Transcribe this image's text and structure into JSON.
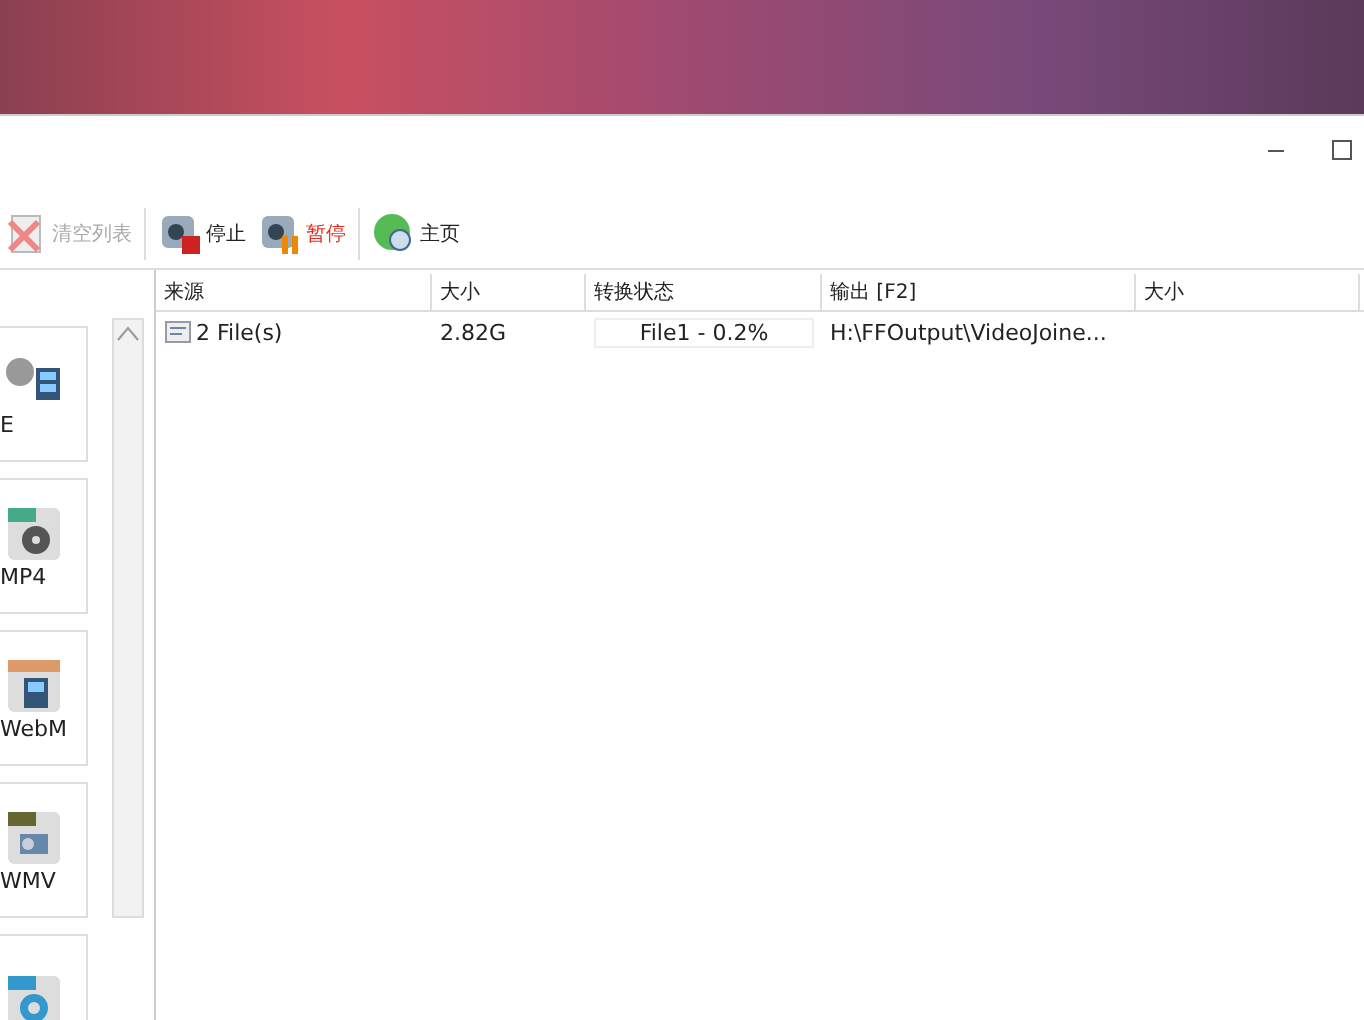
{
  "toolbar": [
    {
      "label": "清空列表",
      "kind": "clear",
      "disabled": true,
      "highlighted": false
    },
    {
      "label": "停止",
      "kind": "stop",
      "disabled": false,
      "highlighted": false
    },
    {
      "label": "暂停",
      "kind": "pause",
      "disabled": false,
      "highlighted": true
    },
    {
      "label": "主页",
      "kind": "home",
      "disabled": false,
      "highlighted": false
    }
  ],
  "formats": [
    {
      "label": "E",
      "kind": "join"
    },
    {
      "label": "MP4",
      "kind": "mp4"
    },
    {
      "label": "WebM",
      "kind": "webm"
    },
    {
      "label": "WMV",
      "kind": "wmv"
    },
    {
      "kind": "mov"
    }
  ],
  "table": {
    "columns": [
      "来源",
      "大小",
      "转换状态",
      "输出 [F2]",
      "大小"
    ],
    "rows": [
      {
        "source": "2 File(s)",
        "size": "2.82G",
        "status": "File1 - 0.2%",
        "output": "H:\\FFOutput\\VideoJoine..."
      }
    ]
  }
}
